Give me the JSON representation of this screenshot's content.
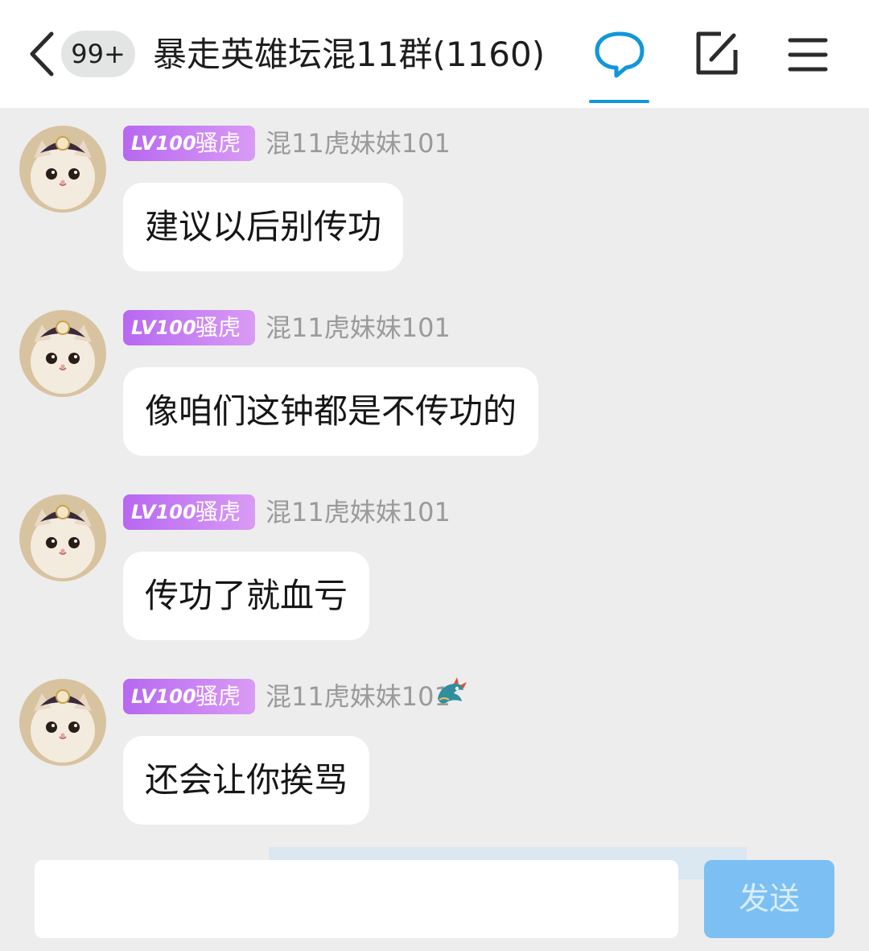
{
  "header": {
    "back_icon": "chevron-left-icon",
    "unread_badge": "99+",
    "title": "暴走英雄坛混11群(1160)",
    "tabs": [
      {
        "icon": "chat-bubble-icon",
        "active": true
      },
      {
        "icon": "edit-icon"
      },
      {
        "icon": "menu-icon"
      }
    ],
    "accent_color": "#1296db"
  },
  "messages": [
    {
      "lv": "LV100",
      "title": "骚虎",
      "nickname": "混11虎妹妹101",
      "text": "建议以后别传功",
      "dragon_badge": false
    },
    {
      "lv": "LV100",
      "title": "骚虎",
      "nickname": "混11虎妹妹101",
      "text": "像咱们这钟都是不传功的",
      "dragon_badge": false
    },
    {
      "lv": "LV100",
      "title": "骚虎",
      "nickname": "混11虎妹妹101",
      "text": "传功了就血亏",
      "dragon_badge": false
    },
    {
      "lv": "LV100",
      "title": "骚虎",
      "nickname": "混11虎妹妹101",
      "text": "还会让你挨骂",
      "dragon_badge": true
    }
  ],
  "input": {
    "value": "",
    "placeholder": "",
    "send_label": "发送"
  },
  "colors": {
    "lv_tag_start": "#b768f0",
    "lv_tag_end": "#d99bf5",
    "send_button": "#7cc0f3",
    "background": "#ededed"
  }
}
